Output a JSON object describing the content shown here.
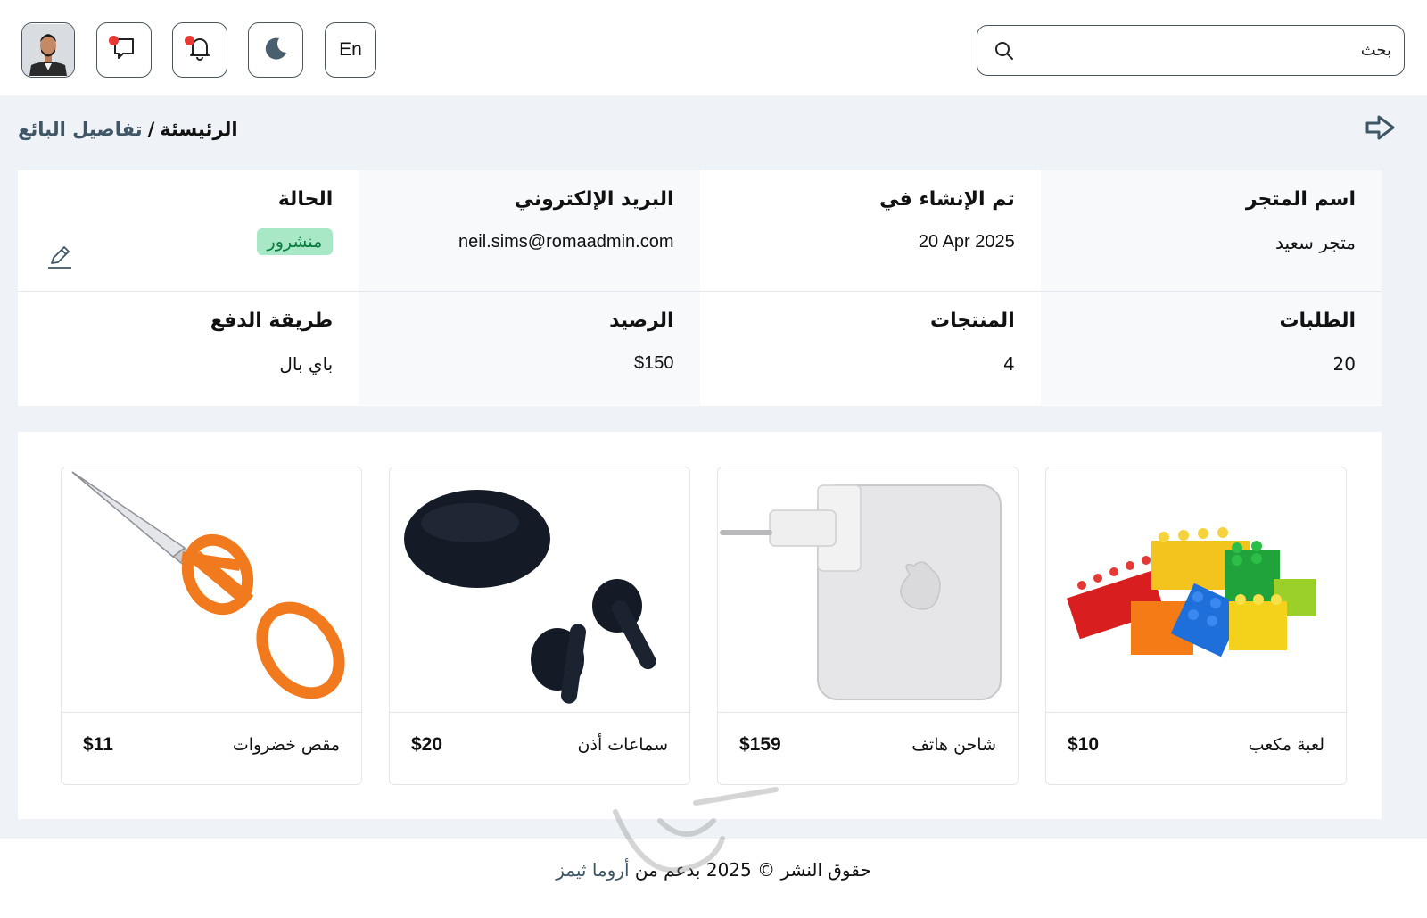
{
  "header": {
    "search_placeholder": "بحث",
    "lang_label": "En",
    "icons": {
      "search": "search-icon",
      "theme": "moon-icon",
      "notifications": "bell-icon",
      "messages": "chat-icon"
    }
  },
  "breadcrumb": {
    "home": "الرئيسئة",
    "separator": "/",
    "current": "تفاصيل البائع"
  },
  "vendor": {
    "store_name_label": "اسم المتجر",
    "store_name": "متجر سعيد",
    "created_label": "تم الإنشاء في",
    "created": "20 Apr 2025",
    "email_label": "البريد الإلكتروني",
    "email": "neil.sims@romaadmin.com",
    "status_label": "الحالة",
    "status": "منشرور",
    "orders_label": "الطلبات",
    "orders": "20",
    "products_label": "المنتجات",
    "products": "4",
    "balance_label": "الرصيد",
    "balance": "$150",
    "payment_label": "طريقة الدفع",
    "payment": "باي بال"
  },
  "products": [
    {
      "name": "لعبة مكعب",
      "price": "$10",
      "image": "lego-bricks"
    },
    {
      "name": "شاحن هاتف",
      "price": "$159",
      "image": "phone-charger"
    },
    {
      "name": "سماعات أذن",
      "price": "$20",
      "image": "earbuds"
    },
    {
      "name": "مقص خضروات",
      "price": "$11",
      "image": "scissors"
    }
  ],
  "footer": {
    "text": "حقوق النشر © 2025 بدعم من",
    "brand": "أروما ثيمز"
  },
  "colors": {
    "accent": "#3e5665",
    "badge_bg": "#a8e8c6",
    "badge_text": "#0b7a3e",
    "notification_dot": "#e53935"
  }
}
